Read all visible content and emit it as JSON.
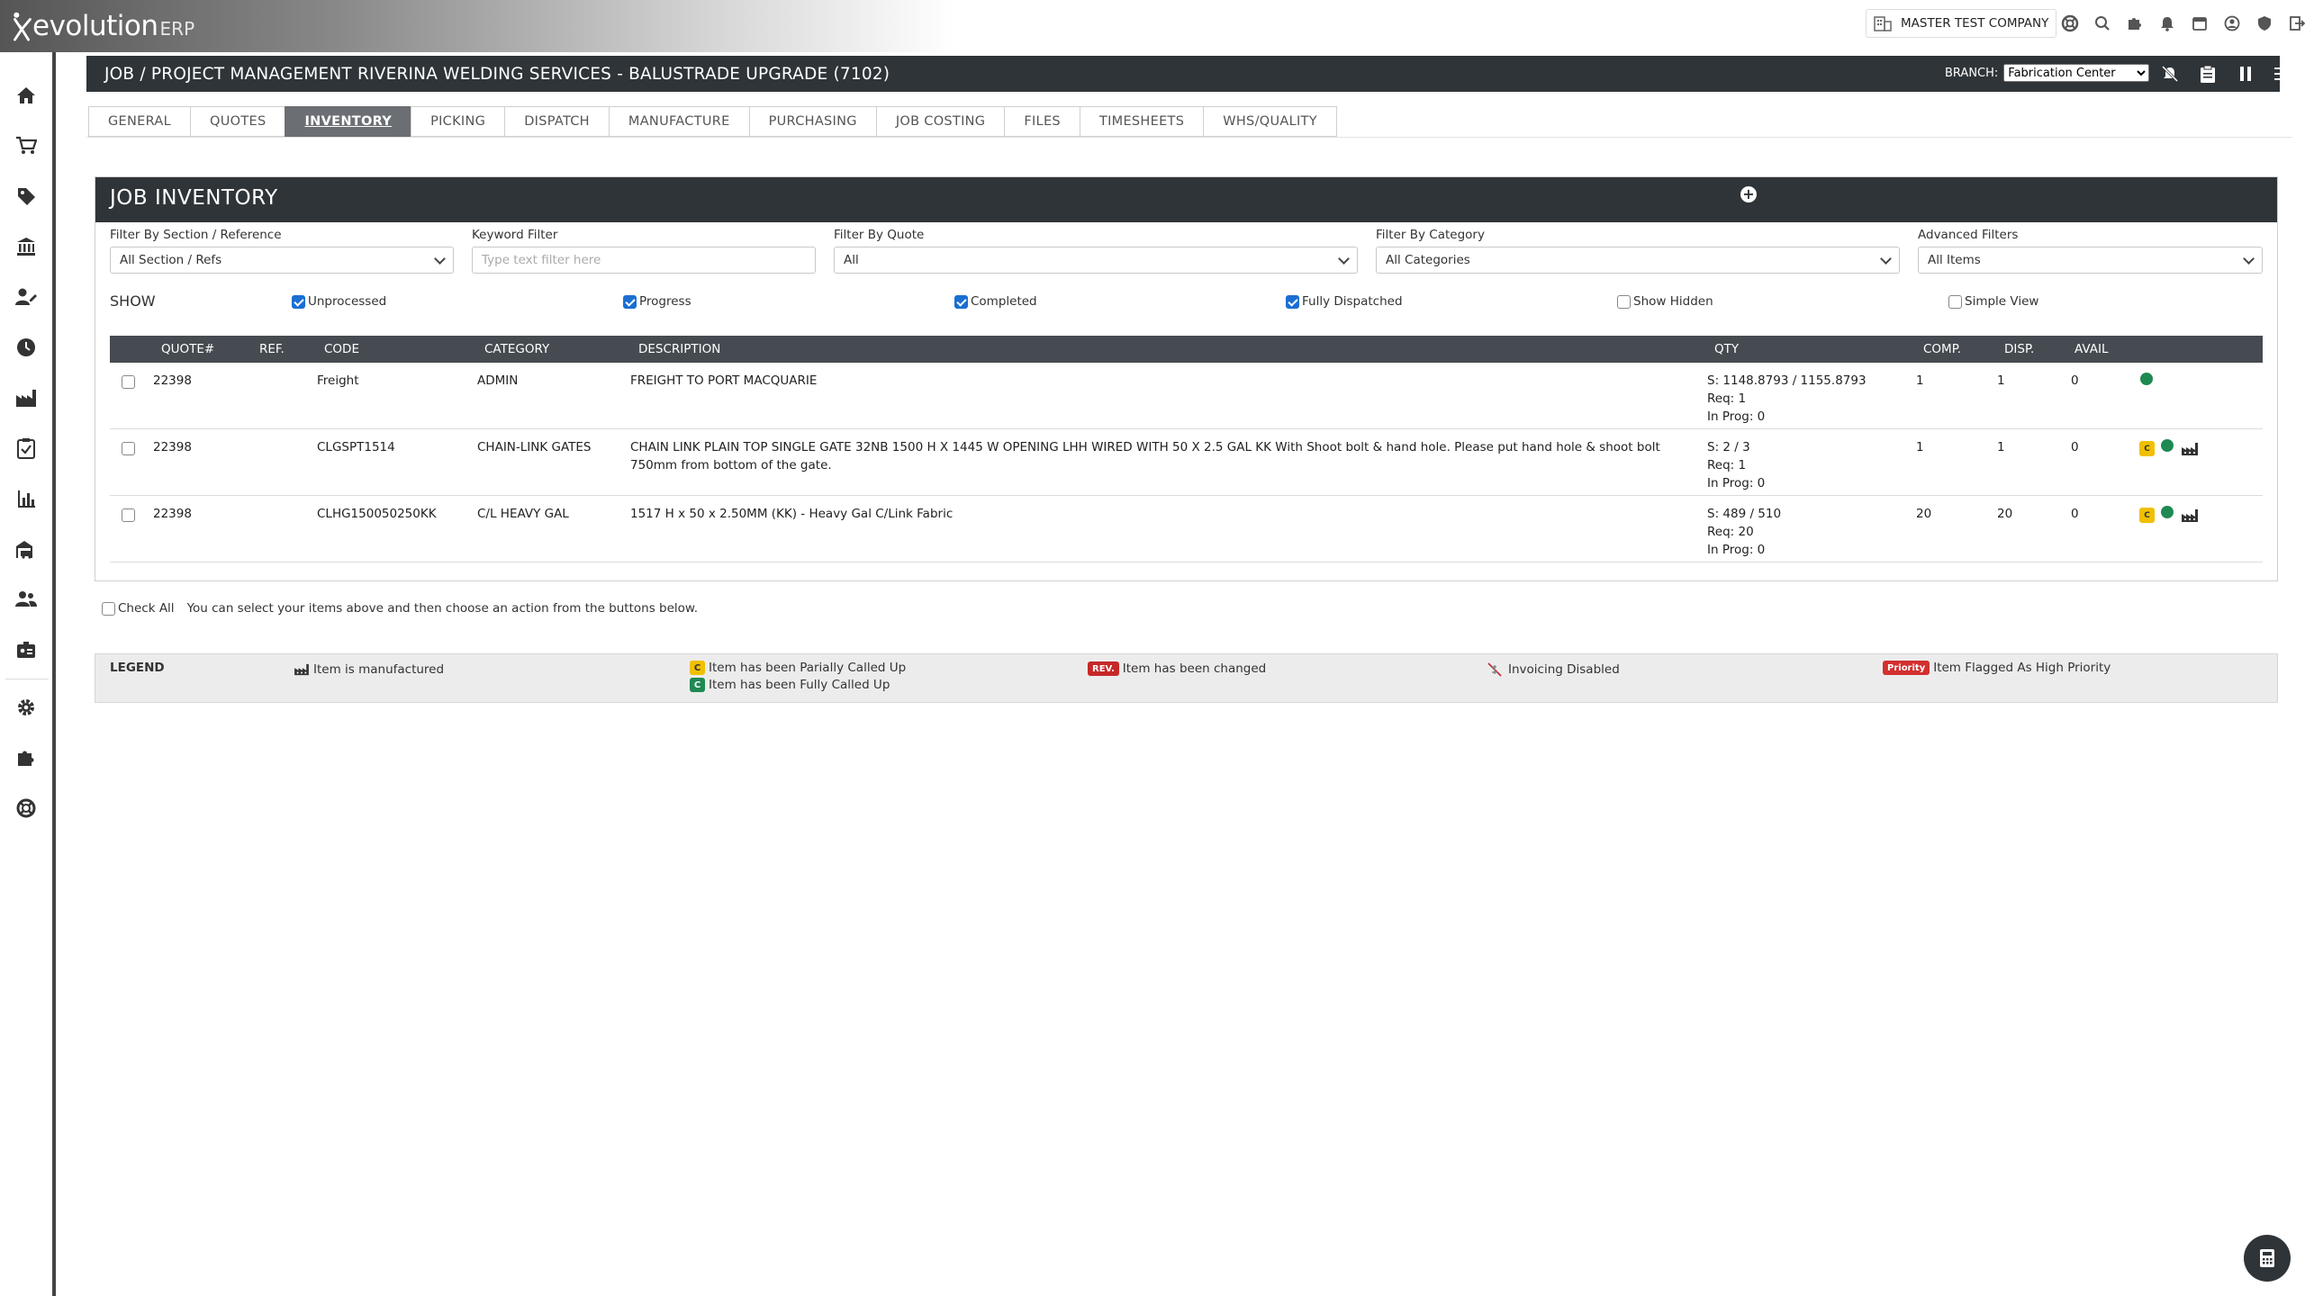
{
  "app": {
    "logo_word": "evolution",
    "logo_suffix": "ERP",
    "company": "MASTER TEST COMPANY"
  },
  "job": {
    "title": "JOB / PROJECT MANAGEMENT RIVERINA WELDING SERVICES - BALUSTRADE UPGRADE (7102)",
    "branch_label": "BRANCH:",
    "branch_value": "Fabrication Center"
  },
  "tabs": [
    {
      "label": "GENERAL"
    },
    {
      "label": "QUOTES"
    },
    {
      "label": "INVENTORY"
    },
    {
      "label": "PICKING"
    },
    {
      "label": "DISPATCH"
    },
    {
      "label": "MANUFACTURE"
    },
    {
      "label": "PURCHASING"
    },
    {
      "label": "JOB COSTING"
    },
    {
      "label": "FILES"
    },
    {
      "label": "TIMESHEETS"
    },
    {
      "label": "WHS/QUALITY"
    }
  ],
  "active_tab": "INVENTORY",
  "panel": {
    "title": "JOB INVENTORY",
    "add_symbol": "+"
  },
  "filters": {
    "section": {
      "label": "Filter By Section / Reference",
      "value": "All Section / Refs"
    },
    "keyword": {
      "label": "Keyword Filter",
      "placeholder": "Type text filter here"
    },
    "quote": {
      "label": "Filter By Quote",
      "value": "All"
    },
    "category": {
      "label": "Filter By Category",
      "value": "All Categories"
    },
    "advanced": {
      "label": "Advanced Filters",
      "value": "All Items"
    }
  },
  "show": {
    "label": "SHOW",
    "options": [
      {
        "label": "Unprocessed",
        "checked": true
      },
      {
        "label": "Progress",
        "checked": true
      },
      {
        "label": "Completed",
        "checked": true
      },
      {
        "label": "Fully Dispatched",
        "checked": true
      },
      {
        "label": "Show Hidden",
        "checked": false
      },
      {
        "label": "Simple View",
        "checked": false
      }
    ]
  },
  "table": {
    "headers": {
      "quote": "QUOTE#",
      "ref": "REF.",
      "code": "CODE",
      "category": "CATEGORY",
      "description": "DESCRIPTION",
      "qty": "QTY",
      "comp": "COMP.",
      "disp": "DISP.",
      "avail": "AVAIL"
    },
    "rows": [
      {
        "quote": "22398",
        "ref": "",
        "code": "Freight",
        "category": "ADMIN",
        "description": "FREIGHT TO PORT MACQUARIE",
        "qty_s": "S: 1148.8793 / 1155.8793",
        "qty_req": "Req: 1",
        "qty_prog": "In Prog: 0",
        "comp": "1",
        "disp": "1",
        "avail": "0",
        "called_up_badge": false,
        "manufactured": false
      },
      {
        "quote": "22398",
        "ref": "",
        "code": "CLGSPT1514",
        "category": "CHAIN-LINK GATES",
        "description": "CHAIN LINK PLAIN TOP SINGLE GATE 32NB 1500 H X 1445 W OPENING LHH WIRED WITH 50 X 2.5 GAL KK With Shoot bolt & hand hole. Please put hand hole & shoot bolt 750mm from bottom of the gate.",
        "qty_s": "S: 2 / 3",
        "qty_req": "Req: 1",
        "qty_prog": "In Prog: 0",
        "comp": "1",
        "disp": "1",
        "avail": "0",
        "called_up_badge": true,
        "manufactured": true
      },
      {
        "quote": "22398",
        "ref": "",
        "code": "CLHG150050250KK",
        "category": "C/L HEAVY GAL",
        "description": "1517 H x 50 x 2.50MM (KK) - Heavy Gal C/Link Fabric",
        "qty_s": "S: 489 / 510",
        "qty_req": "Req: 20",
        "qty_prog": "In Prog: 0",
        "comp": "20",
        "disp": "20",
        "avail": "0",
        "called_up_badge": true,
        "manufactured": true
      }
    ],
    "badge_letter": "C"
  },
  "check_all": {
    "label": "Check All",
    "hint": "You can select your items above and then choose an action from the buttons below."
  },
  "legend": {
    "title": "LEGEND",
    "manufactured": "Item is manufactured",
    "partial_badge": "C",
    "partial": "Item has been Parially Called Up",
    "full_badge": "C",
    "full": "Item has been Fully Called Up",
    "rev_badge": "REV.",
    "changed": "Item has been changed",
    "invoicing": "Invoicing Disabled",
    "priority_badge": "Priority",
    "priority": "Item Flagged As High Priority"
  },
  "colors": {
    "header_dark": "#2f3438",
    "table_header": "#454b50",
    "status_green": "#1e8a52",
    "partial_yellow": "#f0c000",
    "rev_red": "#c62828",
    "priority_red": "#d32f2f",
    "checkbox_blue": "#1a6fd1"
  },
  "icons": {
    "sidebar": [
      "home-icon",
      "cart-icon",
      "tag-icon",
      "bank-icon",
      "user-edit-icon",
      "clock-icon",
      "factory-icon",
      "clipboard-check-icon",
      "bar-chart-icon",
      "warehouse-truck-icon",
      "users-icon",
      "id-card-icon",
      "gear-icon",
      "puzzle-icon",
      "lifebuoy-icon"
    ],
    "top": [
      "lifebuoy-icon",
      "search-icon",
      "puzzle-icon",
      "bell-icon",
      "calendar-icon",
      "user-circle-icon",
      "shield-icon",
      "logout-icon"
    ],
    "job": [
      "bell-slash-icon",
      "clipboard-icon",
      "pause-icon",
      "menu-lines-icon",
      "print-icon",
      "timer-icon"
    ]
  }
}
